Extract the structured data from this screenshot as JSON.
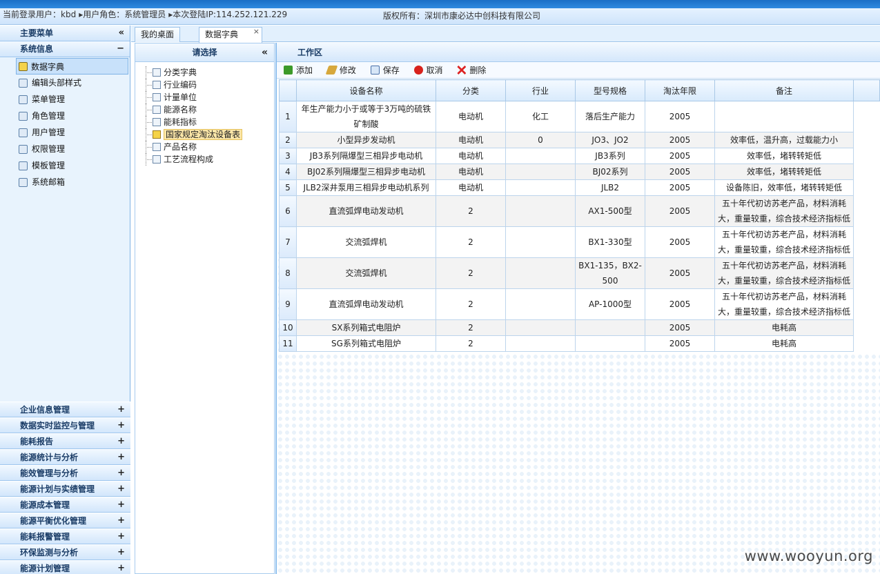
{
  "header": {
    "user": "当前登录用户：kbd",
    "role": "▸用户角色：系统管理员",
    "ip": "▸本次登陆IP:114.252.121.229",
    "copyright": "版权所有：深圳市康必达中创科技有限公司"
  },
  "sidebar": {
    "main_title": "主要菜单",
    "main_toggle": "«",
    "section_title": "系统信息",
    "section_toggle": "−",
    "items": [
      {
        "label": "数据字典",
        "icon": "dictionary-icon",
        "active": true
      },
      {
        "label": "编辑头部样式",
        "icon": "edit-style-icon"
      },
      {
        "label": "菜单管理",
        "icon": "menu-icon"
      },
      {
        "label": "角色管理",
        "icon": "role-icon"
      },
      {
        "label": "用户管理",
        "icon": "users-icon"
      },
      {
        "label": "权限管理",
        "icon": "permission-icon"
      },
      {
        "label": "模板管理",
        "icon": "template-icon"
      },
      {
        "label": "系统邮箱",
        "icon": "mailbox-icon"
      }
    ],
    "groups": [
      "企业信息管理",
      "数据实时监控与管理",
      "能耗报告",
      "能源统计与分析",
      "能效管理与分析",
      "能源计划与实绩管理",
      "能源成本管理",
      "能源平衡优化管理",
      "能耗报警管理",
      "环保监测与分析",
      "能源计划管理"
    ],
    "group_toggle": "+"
  },
  "tabs": [
    {
      "label": "我的桌面"
    },
    {
      "label": "数据字典",
      "close": "×"
    }
  ],
  "tree": {
    "title": "请选择",
    "toggle": "«",
    "nodes": [
      "分类字典",
      "行业编码",
      "计量单位",
      "能源名称",
      "能耗指标",
      "国家规定淘汰设备表",
      "产品名称",
      "工艺流程构成"
    ]
  },
  "work": {
    "title": "工作区",
    "toolbar": {
      "add": "添加",
      "edit": "修改",
      "save": "保存",
      "cancel": "取消",
      "delete": "删除"
    },
    "columns": [
      "设备名称",
      "分类",
      "行业",
      "型号规格",
      "淘汰年限",
      "备注"
    ],
    "rows": [
      {
        "n": "1",
        "name": "年生产能力小于或等于3万吨的硫铁矿制酸",
        "cat": "电动机",
        "ind": "化工",
        "model": "落后生产能力",
        "year": "2005",
        "note": ""
      },
      {
        "n": "2",
        "name": "小型异步发动机",
        "cat": "电动机",
        "ind": "0",
        "model": "JO3、JO2",
        "year": "2005",
        "note": "效率低，温升高，过载能力小"
      },
      {
        "n": "3",
        "name": "JB3系列隔爆型三相异步电动机",
        "cat": "电动机",
        "ind": "",
        "model": "JB3系列",
        "year": "2005",
        "note": "效率低，堵转转矩低"
      },
      {
        "n": "4",
        "name": "BJ02系列隔爆型三相异步电动机",
        "cat": "电动机",
        "ind": "",
        "model": "BJ02系列",
        "year": "2005",
        "note": "效率低，堵转转矩低"
      },
      {
        "n": "5",
        "name": "JLB2深井泵用三相异步电动机系列",
        "cat": "电动机",
        "ind": "",
        "model": "JLB2",
        "year": "2005",
        "note": "设备陈旧，效率低，堵转转矩低"
      },
      {
        "n": "6",
        "name": "直流弧焊电动发动机",
        "cat": "2",
        "ind": "",
        "model": "AX1-500型",
        "year": "2005",
        "note": "五十年代初访苏老产品，材料消耗大，重量较重，综合技术经济指标低"
      },
      {
        "n": "7",
        "name": "交流弧焊机",
        "cat": "2",
        "ind": "",
        "model": "BX1-330型",
        "year": "2005",
        "note": "五十年代初访苏老产品，材料消耗大，重量较重，综合技术经济指标低"
      },
      {
        "n": "8",
        "name": "交流弧焊机",
        "cat": "2",
        "ind": "",
        "model": "BX1-135，BX2-500",
        "year": "2005",
        "note": "五十年代初访苏老产品，材料消耗大，重量较重，综合技术经济指标低"
      },
      {
        "n": "9",
        "name": "直流弧焊电动发动机",
        "cat": "2",
        "ind": "",
        "model": "AP-1000型",
        "year": "2005",
        "note": "五十年代初访苏老产品，材料消耗大，重量较重，综合技术经济指标低"
      },
      {
        "n": "10",
        "name": "SX系列箱式电阻炉",
        "cat": "2",
        "ind": "",
        "model": "",
        "year": "2005",
        "note": "电耗高"
      },
      {
        "n": "11",
        "name": "SG系列箱式电阻炉",
        "cat": "2",
        "ind": "",
        "model": "",
        "year": "2005",
        "note": "电耗高"
      }
    ]
  },
  "watermark": "www.wooyun.org"
}
